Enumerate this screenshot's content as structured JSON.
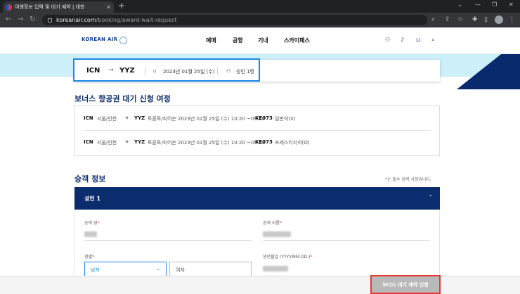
{
  "browser": {
    "tab_title": "여행정보 입력 및 대기 예약 | 대한",
    "new_tab": "+",
    "url_host": "koreanair.com",
    "url_path": "/booking/award-wait-request"
  },
  "header": {
    "logo_text": "KOREAN AIR",
    "nav": [
      "예매",
      "공항",
      "기내",
      "스카이패스"
    ]
  },
  "summary": {
    "origin": "ICN",
    "destination": "YYZ",
    "date": "2023년 01월 25일 (수)",
    "passengers": "성인 1명"
  },
  "itinerary": {
    "title": "보너스 항공권 대기 신청 여정",
    "flights": [
      {
        "from_code": "ICN",
        "from_city": "서울/인천",
        "to_code": "YYZ",
        "to_city": "토론토/피어슨",
        "datetime": "2023년 01월 25일 (수) 10:20 ~09:20",
        "flight_no": "KE073",
        "cabin": "일반석(X)"
      },
      {
        "from_code": "ICN",
        "from_city": "서울/인천",
        "to_code": "YYZ",
        "to_city": "토론토/피어슨",
        "datetime": "2023년 01월 25일 (수) 10:20 ~09:20",
        "flight_no": "KE073",
        "cabin": "프레스티지석(O)"
      }
    ]
  },
  "passenger": {
    "title": "승객 정보",
    "required_note": "는 필수 입력 사항입니다.",
    "required_star": "*",
    "bar_title": "성인 1",
    "fields": {
      "last_name_label": "승객 성",
      "first_name_label": "승객 이름",
      "gender_label": "성별",
      "birth_label": "생년월일 (YYYY.MM.DD.)"
    },
    "gender_selected": "남자",
    "gender_other": "여자"
  },
  "footer": {
    "submit_label": "보너스 대기 예약 신청"
  }
}
